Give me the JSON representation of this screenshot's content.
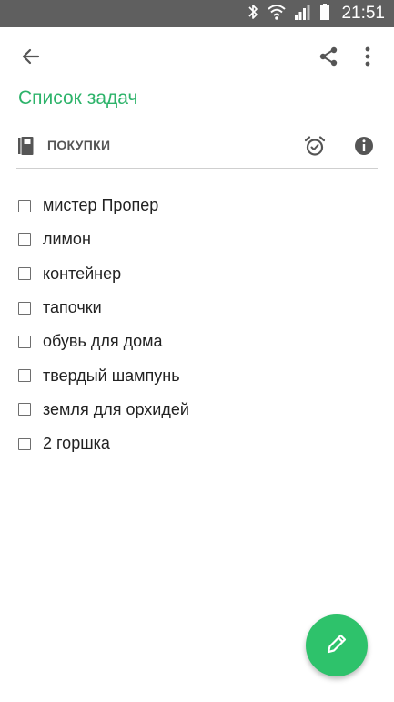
{
  "status_bar": {
    "time": "21:51",
    "icons": [
      "bluetooth-icon",
      "wifi-icon",
      "signal-icon",
      "battery-icon"
    ]
  },
  "toolbar": {
    "back_icon": "arrow-back-icon",
    "share_icon": "share-icon",
    "more_icon": "more-vert-icon"
  },
  "note": {
    "title": "Список задач",
    "category": "ПОКУПКИ",
    "category_icon": "notebook-icon",
    "alarm_icon": "alarm-icon",
    "info_icon": "info-icon",
    "tasks": [
      {
        "text": "мистер Пропер",
        "checked": false
      },
      {
        "text": "лимон",
        "checked": false
      },
      {
        "text": "контейнер",
        "checked": false
      },
      {
        "text": "тапочки",
        "checked": false
      },
      {
        "text": "обувь для дома",
        "checked": false
      },
      {
        "text": "твердый шампунь",
        "checked": false
      },
      {
        "text": "земля для орхидей",
        "checked": false
      },
      {
        "text": "2 горшка",
        "checked": false
      }
    ]
  },
  "fab": {
    "icon": "pencil-icon"
  },
  "colors": {
    "accent": "#2db36a",
    "fab": "#2ec26b",
    "status_bar": "#5f5f5f"
  }
}
